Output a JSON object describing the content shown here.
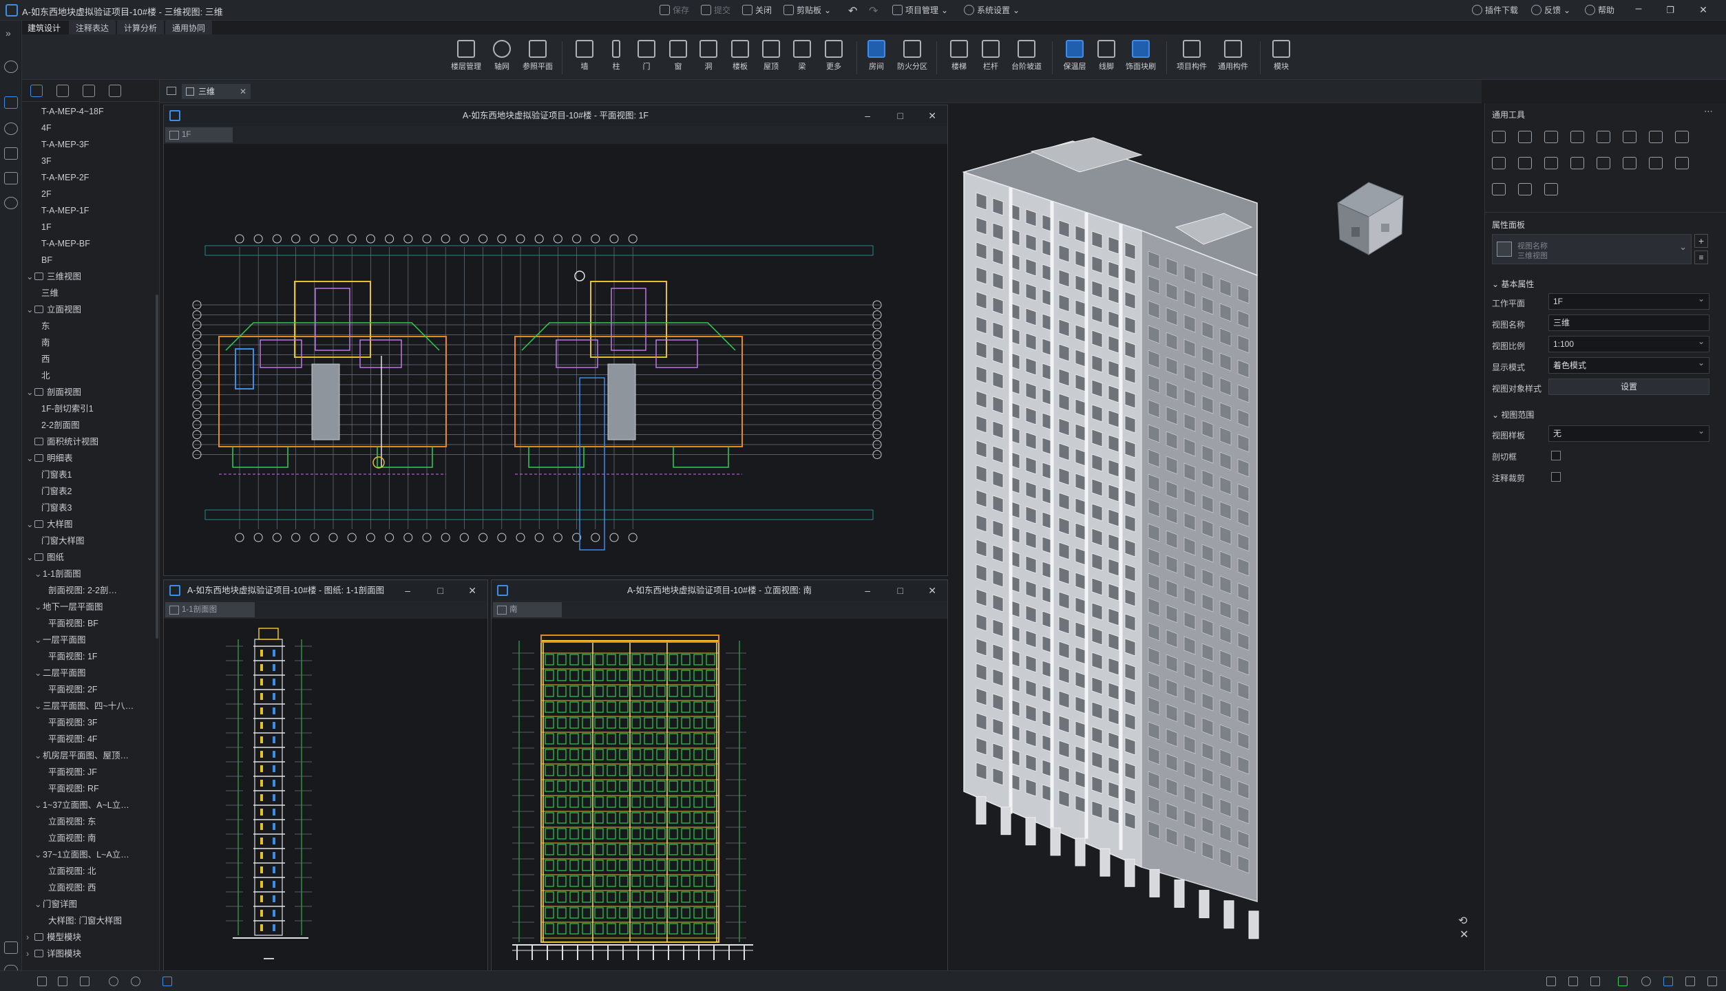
{
  "title": "A-如东西地块虚拟验证项目-10#楼 - 三维视图: 三维",
  "topbar": {
    "save": "保存",
    "submit": "提交",
    "close": "关闭",
    "clipboard": "剪贴板",
    "project_mgmt": "项目管理",
    "system_settings": "系统设置",
    "plugin_download": "插件下载",
    "feedback": "反馈",
    "help": "帮助",
    "minimize": "–",
    "restore": "❐",
    "close_win": "✕"
  },
  "menu_tabs": [
    "建筑设计",
    "注释表达",
    "计算分析",
    "通用协同"
  ],
  "ribbon": [
    "楼层管理",
    "轴网",
    "参照平面",
    "墙",
    "柱",
    "门",
    "窗",
    "洞",
    "楼板",
    "屋顶",
    "梁",
    "更多",
    "房间",
    "防火分区",
    "楼梯",
    "栏杆",
    "台阶坡道",
    "保温层",
    "线脚",
    "饰面块刷",
    "项目构件",
    "通用构件",
    "模块"
  ],
  "doc_tab": {
    "label": "三维",
    "close": "✕"
  },
  "tree": [
    {
      "label": "T-A-MEP-4~18F",
      "indent": 1
    },
    {
      "label": "4F",
      "indent": 1
    },
    {
      "label": "T-A-MEP-3F",
      "indent": 1
    },
    {
      "label": "3F",
      "indent": 1
    },
    {
      "label": "T-A-MEP-2F",
      "indent": 1
    },
    {
      "label": "2F",
      "indent": 1
    },
    {
      "label": "T-A-MEP-1F",
      "indent": 1
    },
    {
      "label": "1F",
      "indent": 1
    },
    {
      "label": "T-A-MEP-BF",
      "indent": 1
    },
    {
      "label": "BF",
      "indent": 1
    },
    {
      "label": "三维视图",
      "indent": 0,
      "folder": true
    },
    {
      "label": "三维",
      "indent": 1
    },
    {
      "label": "立面视图",
      "indent": 0,
      "folder": true
    },
    {
      "label": "东",
      "indent": 1
    },
    {
      "label": "南",
      "indent": 1
    },
    {
      "label": "西",
      "indent": 1
    },
    {
      "label": "北",
      "indent": 1
    },
    {
      "label": "剖面视图",
      "indent": 0,
      "folder": true
    },
    {
      "label": "1F-剖切索引1",
      "indent": 1
    },
    {
      "label": "2-2剖面图",
      "indent": 1
    },
    {
      "label": "面积统计视图",
      "indent": 0,
      "folder": true,
      "noarrow": true
    },
    {
      "label": "明细表",
      "indent": 0,
      "folder": true
    },
    {
      "label": "门窗表1",
      "indent": 1
    },
    {
      "label": "门窗表2",
      "indent": 1
    },
    {
      "label": "门窗表3",
      "indent": 1
    },
    {
      "label": "大样图",
      "indent": 0,
      "folder": true
    },
    {
      "label": "门窗大样图",
      "indent": 1
    },
    {
      "label": "图纸",
      "indent": 0,
      "folder": true
    },
    {
      "label": "1-1剖面图",
      "indent": 1,
      "arrow": true
    },
    {
      "label": "剖面视图: 2-2剖…",
      "indent": 2
    },
    {
      "label": "地下一层平面图",
      "indent": 1,
      "arrow": true
    },
    {
      "label": "平面视图: BF",
      "indent": 2
    },
    {
      "label": "一层平面图",
      "indent": 1,
      "arrow": true
    },
    {
      "label": "平面视图: 1F",
      "indent": 2
    },
    {
      "label": "二层平面图",
      "indent": 1,
      "arrow": true
    },
    {
      "label": "平面视图: 2F",
      "indent": 2
    },
    {
      "label": "三层平面图、四~十八…",
      "indent": 1,
      "arrow": true
    },
    {
      "label": "平面视图: 3F",
      "indent": 2
    },
    {
      "label": "平面视图: 4F",
      "indent": 2
    },
    {
      "label": "机房层平面图、屋顶…",
      "indent": 1,
      "arrow": true
    },
    {
      "label": "平面视图: JF",
      "indent": 2
    },
    {
      "label": "平面视图: RF",
      "indent": 2
    },
    {
      "label": "1~37立面图、A~L立…",
      "indent": 1,
      "arrow": true
    },
    {
      "label": "立面视图: 东",
      "indent": 2
    },
    {
      "label": "立面视图: 南",
      "indent": 2
    },
    {
      "label": "37~1立面图、L~A立…",
      "indent": 1,
      "arrow": true
    },
    {
      "label": "立面视图: 北",
      "indent": 2
    },
    {
      "label": "立面视图: 西",
      "indent": 2
    },
    {
      "label": "门窗详图",
      "indent": 1,
      "arrow": true
    },
    {
      "label": "大样图: 门窗大样图",
      "indent": 2
    },
    {
      "label": "模型模块",
      "indent": 0,
      "folder": true,
      "collapsed": true
    },
    {
      "label": "详图模块",
      "indent": 0,
      "folder": true,
      "collapsed": true
    }
  ],
  "windows": {
    "plan": {
      "title": "A-如东西地块虚拟验证项目-10#楼 - 平面视图: 1F",
      "tab": "1F"
    },
    "section": {
      "title": "A-如东西地块虚拟验证项目-10#楼 - 图纸: 1-1剖面图",
      "tab": "1-1剖面图"
    },
    "elevation": {
      "title": "A-如东西地块虚拟验证项目-10#楼 - 立面视图: 南",
      "tab": "南"
    }
  },
  "right_panel": {
    "general_tools": "通用工具",
    "props_panel": "属性面板",
    "type_line1": "视图名称",
    "type_line2": "三维视图",
    "basic_props": "基本属性",
    "work_plane_label": "工作平面",
    "work_plane_value": "1F",
    "view_name_label": "视图名称",
    "view_name_value": "三维",
    "view_scale_label": "视图比例",
    "view_scale_value": "1:100",
    "display_mode_label": "显示模式",
    "display_mode_value": "着色模式",
    "view_obj_style_label": "视图对象样式",
    "view_obj_style_btn": "设置",
    "view_range": "视图范围",
    "view_template_label": "视图样板",
    "view_template_value": "无",
    "section_box_label": "剖切框",
    "annotation_crop_label": "注释裁剪"
  },
  "colors": {
    "accent": "#3d8ee6",
    "cad_yellow": "#e6c22a",
    "cad_green": "#2fcf4f",
    "cad_orange": "#e38b1b",
    "cad_cyan": "#27c2c7"
  }
}
